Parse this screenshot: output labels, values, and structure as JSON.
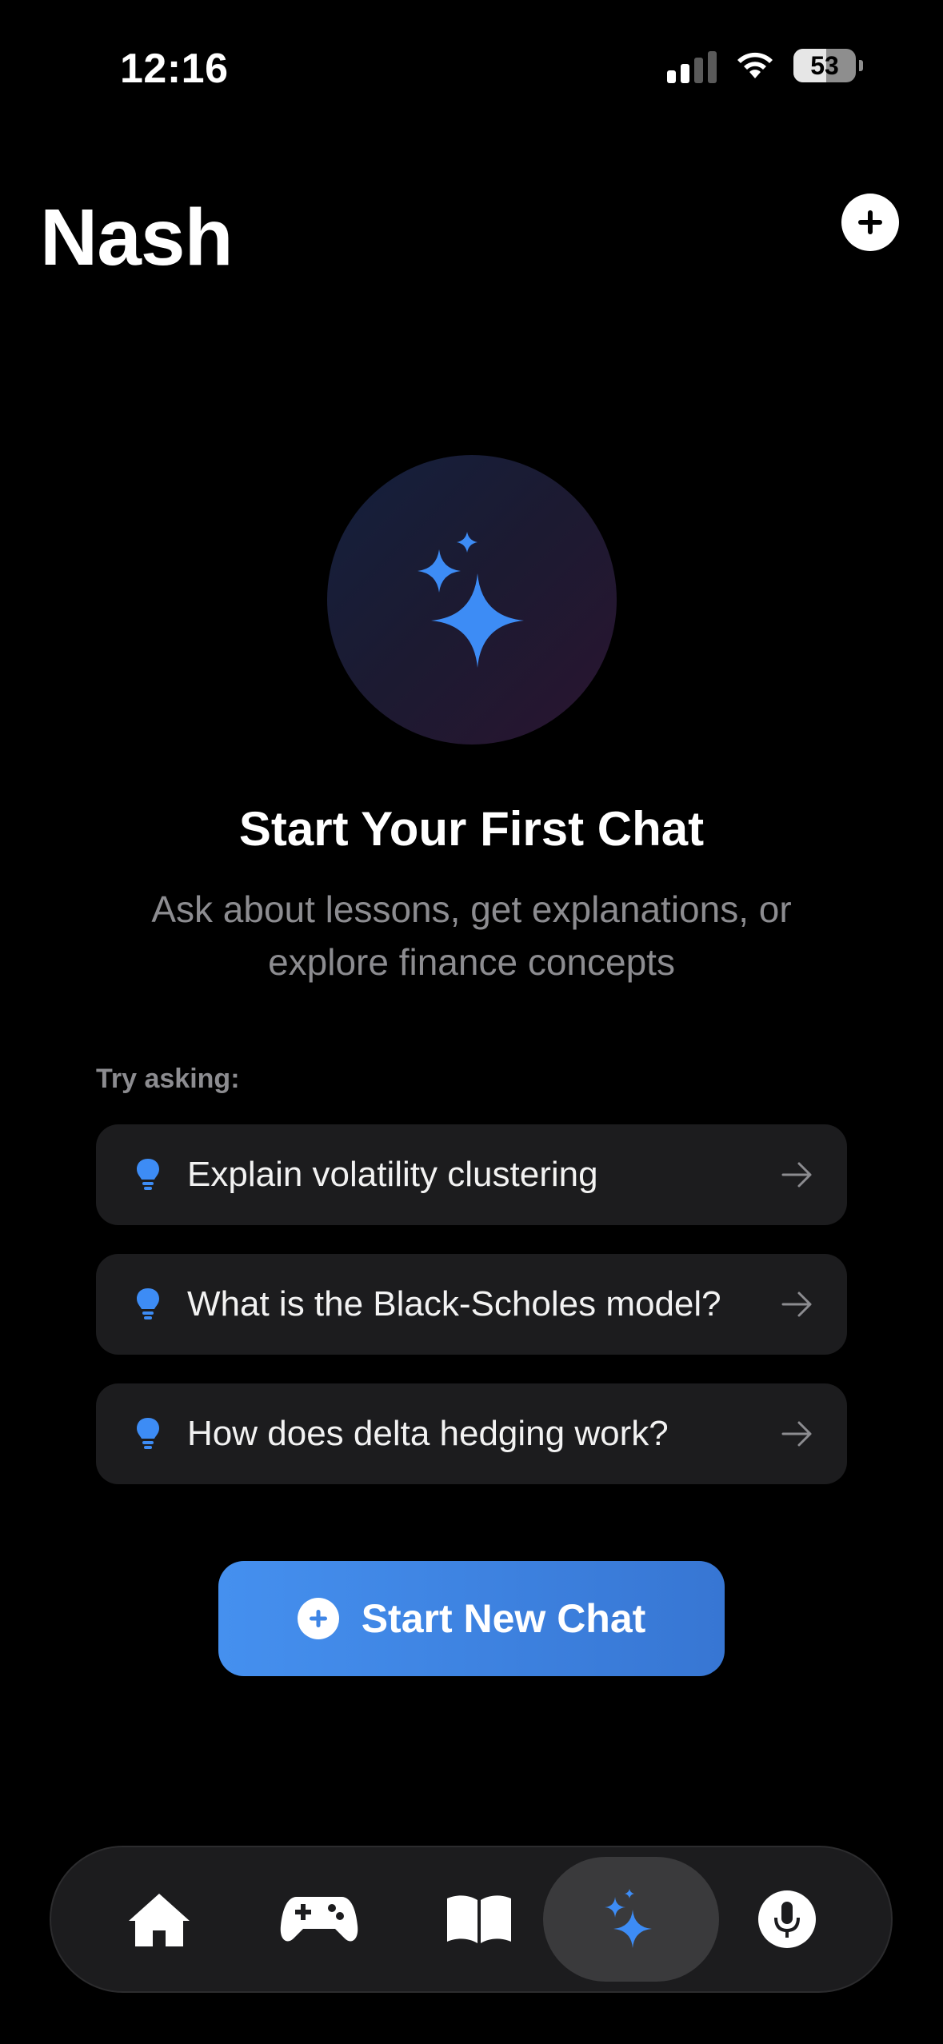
{
  "status_bar": {
    "time": "12:16",
    "battery": "53"
  },
  "header": {
    "title": "Nash"
  },
  "hero": {
    "title": "Start Your First Chat",
    "subtitle": "Ask about lessons, get explanations, or explore finance concepts"
  },
  "suggestions": {
    "label": "Try asking:",
    "items": [
      {
        "text": "Explain volatility clustering"
      },
      {
        "text": "What is the Black-Scholes model?"
      },
      {
        "text": "How does delta hedging work?"
      }
    ]
  },
  "cta": {
    "label": "Start New Chat"
  },
  "tabbar": {
    "items": [
      {
        "icon": "home-icon"
      },
      {
        "icon": "gamepad-icon"
      },
      {
        "icon": "book-icon"
      },
      {
        "icon": "sparkles-icon",
        "active": true
      },
      {
        "icon": "microphone-icon"
      }
    ]
  },
  "colors": {
    "accent": "#3f86e6",
    "background": "#000000",
    "card": "#1c1c1e"
  }
}
